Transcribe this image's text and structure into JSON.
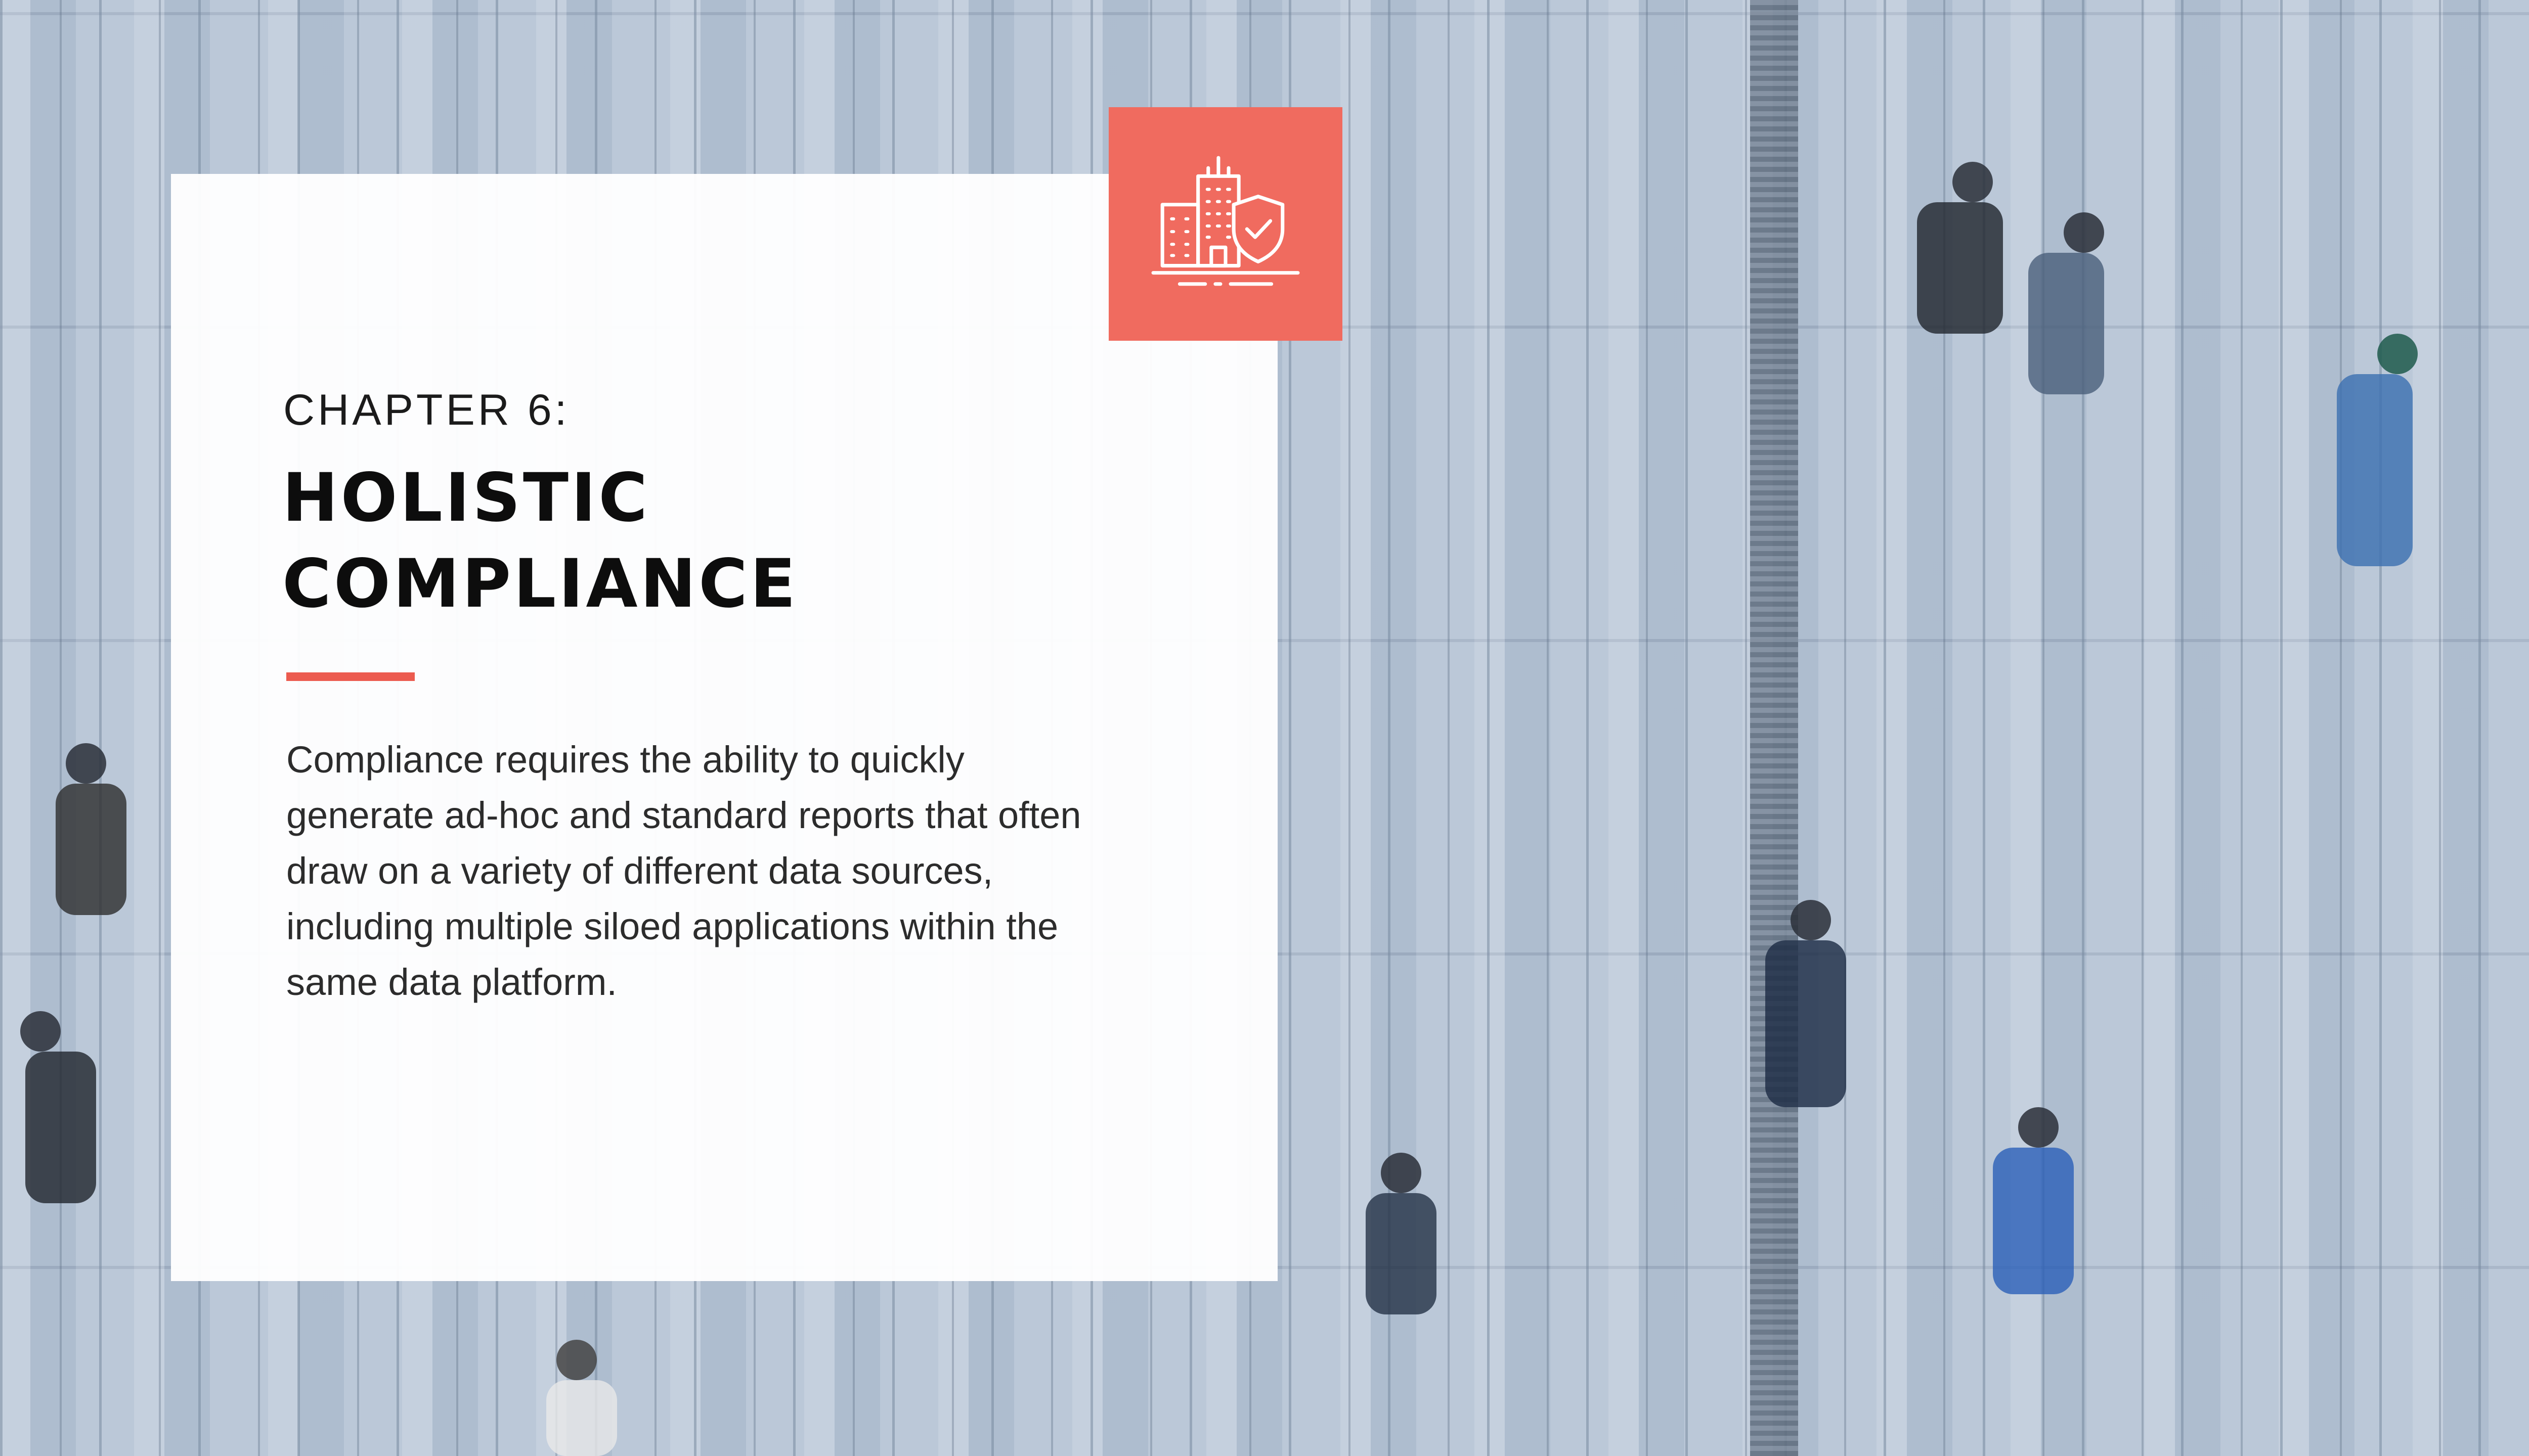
{
  "chapter": {
    "label": "CHAPTER 6:",
    "title_lines": [
      "HOLISTIC",
      "COMPLIANCE"
    ]
  },
  "body": {
    "lines": [
      "Compliance requires the ability to quickly",
      "generate ad-hoc and standard reports that often",
      "draw on a variety of different data sources,",
      "including multiple siloed applications within the",
      "same data platform."
    ]
  },
  "icon": {
    "name": "building-shield-icon",
    "badge_color": "#f06b5f"
  },
  "colors": {
    "accent": "#ec5b4f",
    "card_background": "#ffffff",
    "heading": "#0d0d0d"
  }
}
